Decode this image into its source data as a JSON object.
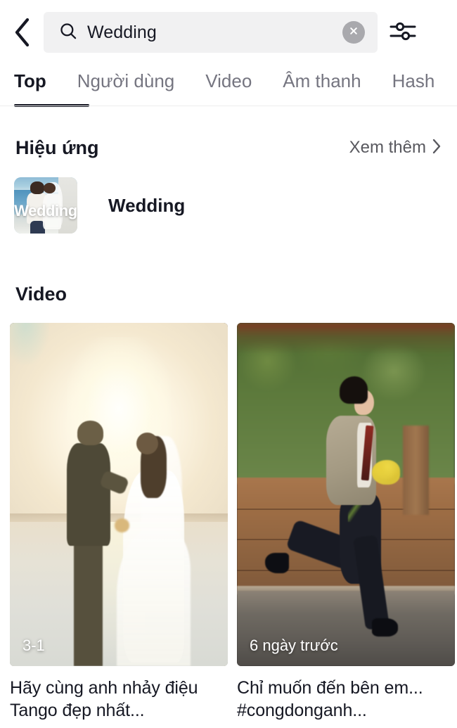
{
  "header": {
    "back_icon": "chevron-left-icon",
    "search": {
      "icon": "search-icon",
      "value": "Wedding",
      "placeholder": "Tìm kiếm",
      "clear_icon": "close-circle-icon"
    },
    "filter_icon": "filter-sliders-icon"
  },
  "tabs": [
    {
      "label": "Top",
      "active": true
    },
    {
      "label": "Người dùng",
      "active": false
    },
    {
      "label": "Video",
      "active": false
    },
    {
      "label": "Âm thanh",
      "active": false
    },
    {
      "label": "Hash",
      "active": false
    }
  ],
  "effects_section": {
    "title": "Hiệu ứng",
    "see_more": "Xem thêm",
    "chevron_icon": "chevron-right-icon",
    "items": [
      {
        "name": "Wedding",
        "thumb_label": "Wedding"
      }
    ]
  },
  "video_section": {
    "title": "Video",
    "items": [
      {
        "badge": "3-1",
        "caption": "Hãy cùng anh nhảy điệu Tango đẹp nhất..."
      },
      {
        "badge": "6 ngày trước",
        "caption": "Chỉ muốn đến bên em...  #congdonganh..."
      }
    ]
  },
  "colors": {
    "text_primary": "#161823",
    "text_secondary": "#757580",
    "search_bg": "#f1f1f2",
    "clear_bg": "#a9a9ad",
    "page_bg": "#ffffff"
  }
}
